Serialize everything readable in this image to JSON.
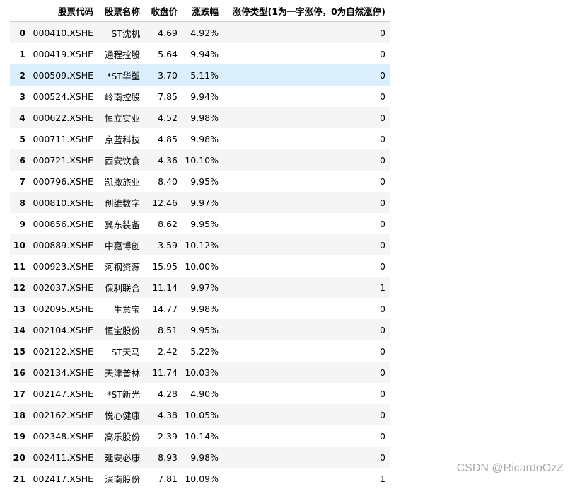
{
  "table": {
    "columns": [
      "股票代码",
      "股票名称",
      "收盘价",
      "涨跌幅",
      "涨停类型(1为一字涨停，0为自然涨停)"
    ],
    "rows": [
      {
        "index": "0",
        "code": "000410.XSHE",
        "name": "ST沈机",
        "close": "4.69",
        "pct": "4.92%",
        "type": "0"
      },
      {
        "index": "1",
        "code": "000419.XSHE",
        "name": "通程控股",
        "close": "5.64",
        "pct": "9.94%",
        "type": "0"
      },
      {
        "index": "2",
        "code": "000509.XSHE",
        "name": "*ST华塑",
        "close": "3.70",
        "pct": "5.11%",
        "type": "0"
      },
      {
        "index": "3",
        "code": "000524.XSHE",
        "name": "岭南控股",
        "close": "7.85",
        "pct": "9.94%",
        "type": "0"
      },
      {
        "index": "4",
        "code": "000622.XSHE",
        "name": "恒立实业",
        "close": "4.52",
        "pct": "9.98%",
        "type": "0"
      },
      {
        "index": "5",
        "code": "000711.XSHE",
        "name": "京蓝科技",
        "close": "4.85",
        "pct": "9.98%",
        "type": "0"
      },
      {
        "index": "6",
        "code": "000721.XSHE",
        "name": "西安饮食",
        "close": "4.36",
        "pct": "10.10%",
        "type": "0"
      },
      {
        "index": "7",
        "code": "000796.XSHE",
        "name": "凯撒旅业",
        "close": "8.40",
        "pct": "9.95%",
        "type": "0"
      },
      {
        "index": "8",
        "code": "000810.XSHE",
        "name": "创维数字",
        "close": "12.46",
        "pct": "9.97%",
        "type": "0"
      },
      {
        "index": "9",
        "code": "000856.XSHE",
        "name": "冀东装备",
        "close": "8.62",
        "pct": "9.95%",
        "type": "0"
      },
      {
        "index": "10",
        "code": "000889.XSHE",
        "name": "中嘉博创",
        "close": "3.59",
        "pct": "10.12%",
        "type": "0"
      },
      {
        "index": "11",
        "code": "000923.XSHE",
        "name": "河钢资源",
        "close": "15.95",
        "pct": "10.00%",
        "type": "0"
      },
      {
        "index": "12",
        "code": "002037.XSHE",
        "name": "保利联合",
        "close": "11.14",
        "pct": "9.97%",
        "type": "1"
      },
      {
        "index": "13",
        "code": "002095.XSHE",
        "name": "生意宝",
        "close": "14.77",
        "pct": "9.98%",
        "type": "0"
      },
      {
        "index": "14",
        "code": "002104.XSHE",
        "name": "恒宝股份",
        "close": "8.51",
        "pct": "9.95%",
        "type": "0"
      },
      {
        "index": "15",
        "code": "002122.XSHE",
        "name": "ST天马",
        "close": "2.42",
        "pct": "5.22%",
        "type": "0"
      },
      {
        "index": "16",
        "code": "002134.XSHE",
        "name": "天津普林",
        "close": "11.74",
        "pct": "10.03%",
        "type": "0"
      },
      {
        "index": "17",
        "code": "002147.XSHE",
        "name": "*ST新光",
        "close": "4.28",
        "pct": "4.90%",
        "type": "0"
      },
      {
        "index": "18",
        "code": "002162.XSHE",
        "name": "悦心健康",
        "close": "4.38",
        "pct": "10.05%",
        "type": "0"
      },
      {
        "index": "19",
        "code": "002348.XSHE",
        "name": "高乐股份",
        "close": "2.39",
        "pct": "10.14%",
        "type": "0"
      },
      {
        "index": "20",
        "code": "002411.XSHE",
        "name": "延安必康",
        "close": "8.93",
        "pct": "9.98%",
        "type": "0"
      },
      {
        "index": "21",
        "code": "002417.XSHE",
        "name": "深南股份",
        "close": "7.81",
        "pct": "10.09%",
        "type": "1"
      }
    ],
    "hovered_row_index": 2
  },
  "watermark": "CSDN @RicardoOzZ",
  "colors": {
    "row_odd": "#f5f5f5",
    "row_hover": "#dbeefc",
    "watermark": "#a9a9a9"
  }
}
